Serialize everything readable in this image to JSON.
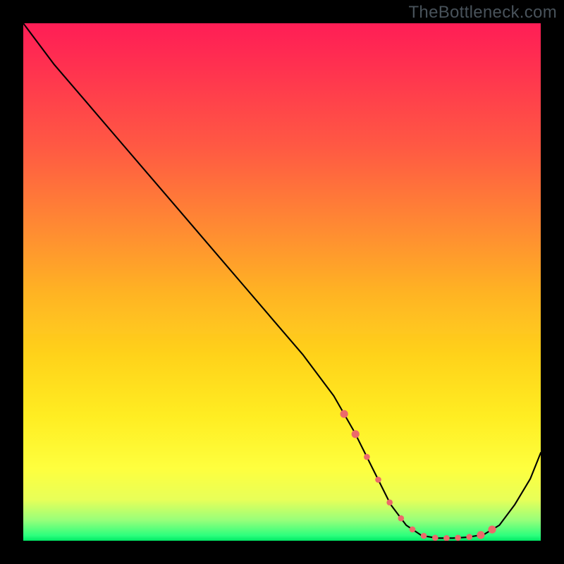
{
  "watermark": "TheBottleneck.com",
  "chart_data": {
    "type": "line",
    "title": "",
    "xlabel": "",
    "ylabel": "",
    "xlim": [
      0,
      100
    ],
    "ylim": [
      0,
      100
    ],
    "x": [
      0,
      6,
      12,
      18,
      24,
      30,
      36,
      42,
      48,
      54,
      60,
      64,
      68,
      71,
      74,
      77,
      80,
      83,
      86,
      89,
      92,
      95,
      98,
      100
    ],
    "y": [
      100,
      92,
      85,
      78,
      71,
      64,
      57,
      50,
      43,
      36,
      28,
      21,
      13,
      7,
      3,
      1,
      0.5,
      0.5,
      0.7,
      1.2,
      3,
      7,
      12,
      17
    ],
    "dot_segment_x_range": [
      62,
      92
    ],
    "gradient_stops": [
      {
        "pos": 0.0,
        "color": "#ff1a53"
      },
      {
        "pos": 0.4,
        "color": "#ff8a2f"
      },
      {
        "pos": 0.75,
        "color": "#ffed22"
      },
      {
        "pos": 0.96,
        "color": "#98ff7a"
      },
      {
        "pos": 1.0,
        "color": "#00e865"
      }
    ]
  }
}
